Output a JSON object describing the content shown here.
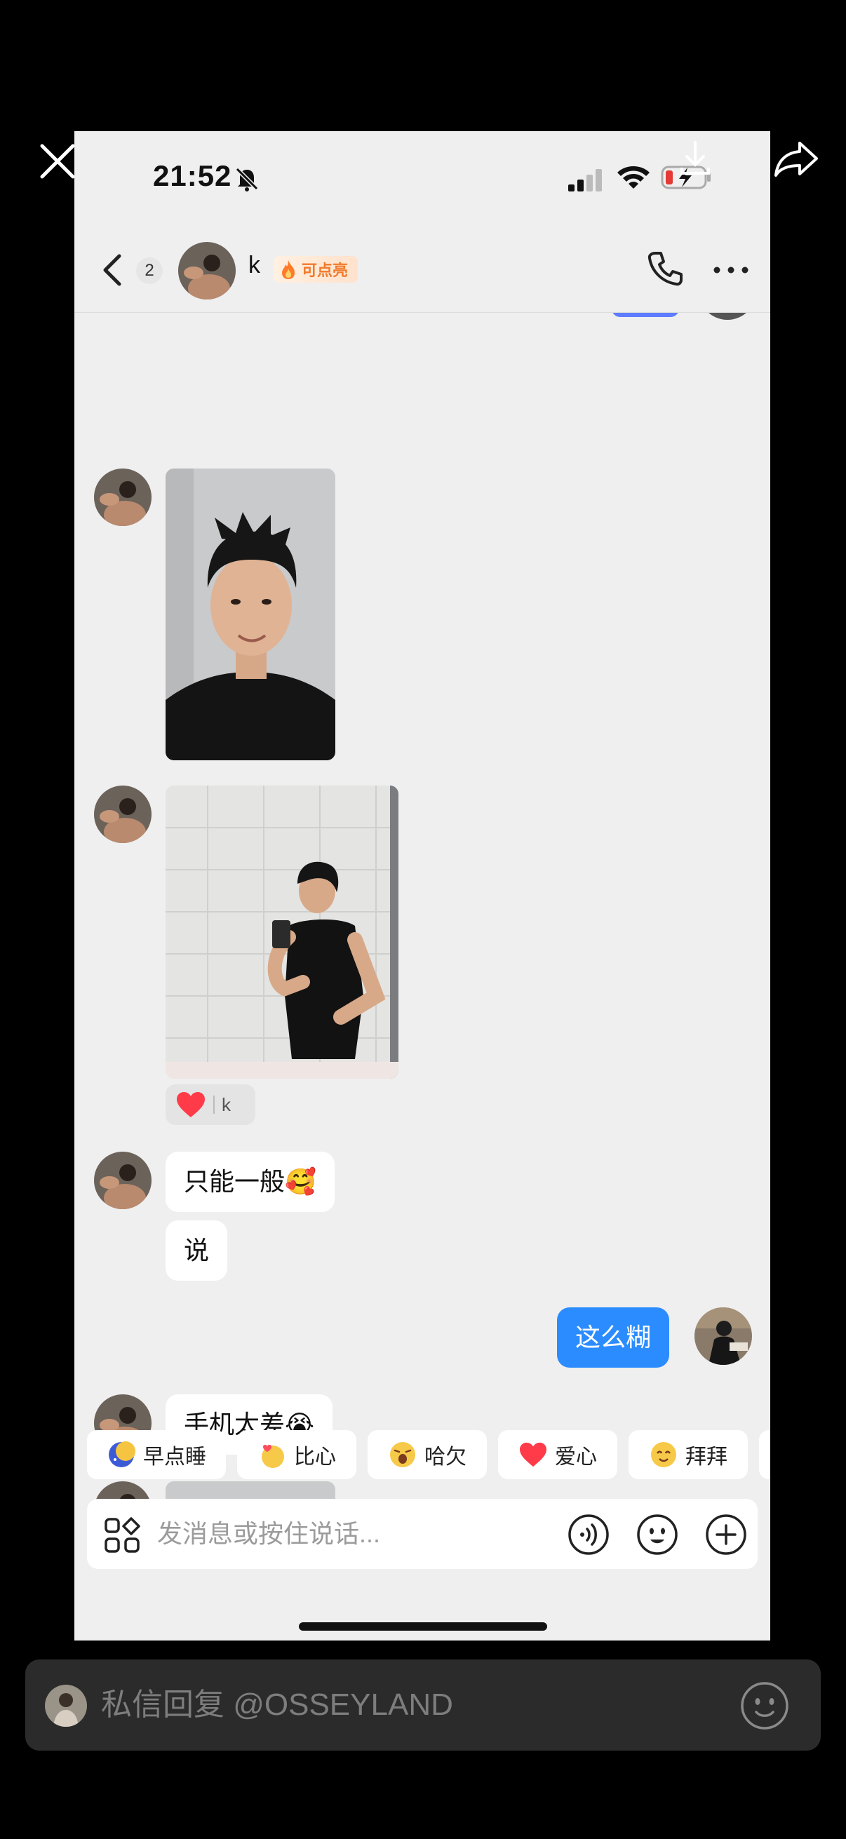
{
  "status_bar": {
    "time": "21:52"
  },
  "header": {
    "unread_count": "2",
    "contact_name": "k",
    "streak_label": "可点亮"
  },
  "messages": {
    "reaction_name": "k",
    "text_1": "只能一般🥰",
    "text_2": "说",
    "outgoing_text": "这么糊",
    "text_3": "手机太差😭"
  },
  "quick_replies": [
    {
      "label": "早点睡",
      "icon": "moon-emoji-icon"
    },
    {
      "label": "比心",
      "icon": "finger-heart-emoji-icon"
    },
    {
      "label": "哈欠",
      "icon": "yawn-emoji-icon"
    },
    {
      "label": "爱心",
      "icon": "heart-emoji-icon"
    },
    {
      "label": "拜拜",
      "icon": "wave-emoji-icon"
    }
  ],
  "composer": {
    "placeholder": "发消息或按住说话..."
  },
  "reply_bar": {
    "placeholder": "私信回复 @OSSEYLAND"
  },
  "colors": {
    "outgoing_bubble": "#2b8cff",
    "heart": "#ff3b4a",
    "streak": "#f07a2a"
  }
}
